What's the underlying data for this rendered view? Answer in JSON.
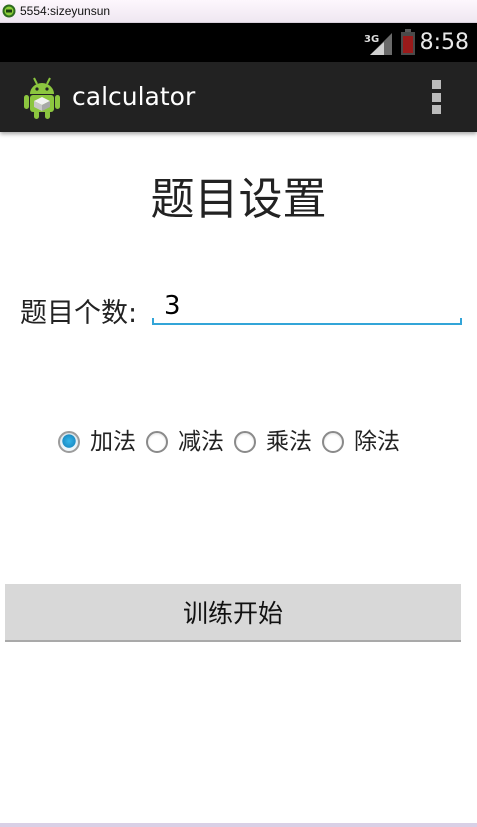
{
  "window": {
    "title": "5554:sizeyunsun",
    "icon": "android-emulator-icon"
  },
  "status_bar": {
    "network": "3G",
    "signal_icon": "signal-icon",
    "battery_icon": "battery-icon",
    "time": "8:58"
  },
  "action_bar": {
    "app_icon": "android-robot-icon",
    "title": "calculator",
    "overflow_icon": "overflow-menu-icon"
  },
  "main": {
    "title": "题目设置",
    "count_label": "题目个数:",
    "count_value": "3",
    "operations": [
      {
        "label": "加法",
        "checked": true
      },
      {
        "label": "减法",
        "checked": false
      },
      {
        "label": "乘法",
        "checked": false
      },
      {
        "label": "除法",
        "checked": false
      }
    ],
    "start_button": "训练开始"
  },
  "colors": {
    "accent": "#33a5d8",
    "action_bar": "#222222",
    "status_bar": "#000000",
    "button": "#d8d8d8"
  }
}
